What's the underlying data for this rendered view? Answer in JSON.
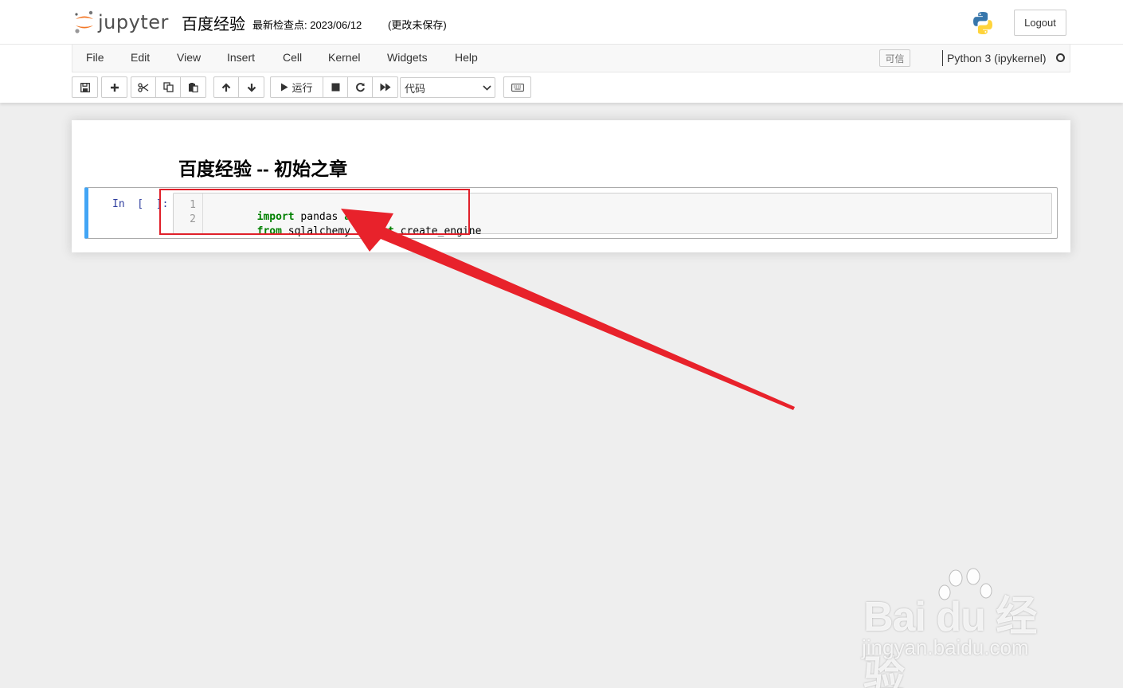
{
  "header": {
    "logo_text": "jupyter",
    "notebook_name": "百度经验",
    "checkpoint": "最新检查点: 2023/06/12",
    "unsaved": "(更改未保存)",
    "logout_label": "Logout"
  },
  "menubar": {
    "items": [
      "File",
      "Edit",
      "View",
      "Insert",
      "Cell",
      "Kernel",
      "Widgets",
      "Help"
    ],
    "trusted_label": "可信",
    "kernel_name": "Python 3 (ipykernel)"
  },
  "toolbar": {
    "run_label": "运行",
    "cell_type": "代码"
  },
  "notebook": {
    "heading": "百度经验 -- 初始之章",
    "cell": {
      "prompt": "In  [  ]:",
      "lines": [
        {
          "num": "1",
          "tokens": [
            {
              "t": "import",
              "kw": true
            },
            {
              "t": " pandas "
            },
            {
              "t": "as",
              "kw": true
            },
            {
              "t": " pd"
            }
          ]
        },
        {
          "num": "2",
          "tokens": [
            {
              "t": "from",
              "kw": true
            },
            {
              "t": " sqlalchemy "
            },
            {
              "t": "import",
              "kw": true
            },
            {
              "t": " create_engine"
            }
          ]
        }
      ]
    }
  },
  "watermark": {
    "brand": "Bai du 经验",
    "url": "jingyan.baidu.com"
  },
  "colors": {
    "cell_selected_bar": "#42a5f5",
    "keyword": "#008000",
    "annotation_red": "#e0202a",
    "prompt_blue": "#303f9f"
  }
}
